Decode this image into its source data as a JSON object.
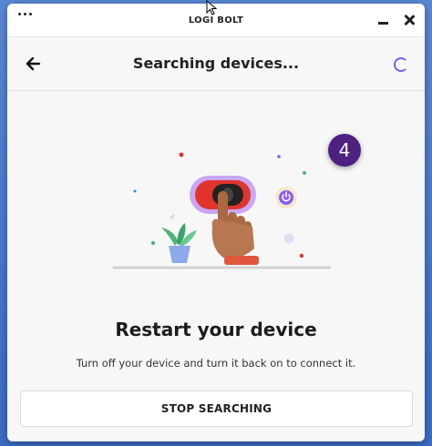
{
  "window": {
    "title": "LOGI BOLT"
  },
  "header": {
    "title": "Searching devices..."
  },
  "step_badge": "4",
  "content": {
    "heading": "Restart your device",
    "description": "Turn off your device and turn it back on to connect it."
  },
  "actions": {
    "stop_label": "STOP SEARCHING"
  },
  "colors": {
    "accent": "#7b5cf0",
    "badge": "#4e2080",
    "switch_red": "#e0342c"
  }
}
